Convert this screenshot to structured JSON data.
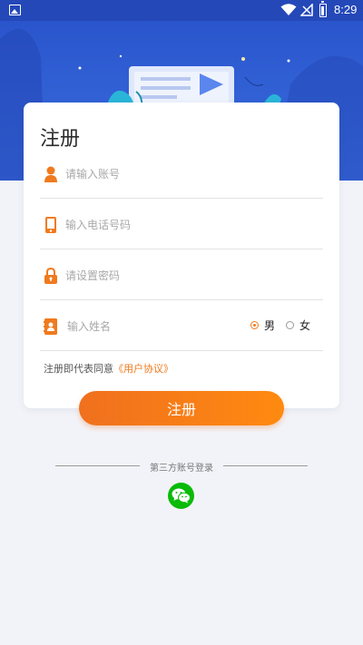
{
  "status_bar": {
    "time": "8:29"
  },
  "card": {
    "title": "注册"
  },
  "fields": {
    "account_placeholder": "请输入账号",
    "phone_placeholder": "输入电话号码",
    "password_placeholder": "请设置密码",
    "name_placeholder": "输入姓名"
  },
  "gender": {
    "male": "男",
    "female": "女",
    "selected": "男"
  },
  "agreement": {
    "prefix": "注册即代表同意",
    "link": "《用户协议》"
  },
  "submit_label": "注册",
  "third_party": {
    "label": "第三方账号登录",
    "icons": [
      "wechat-icon"
    ]
  },
  "colors": {
    "accent": "#f07a1e",
    "banner": "#2a55cc",
    "wechat": "#09bb07"
  }
}
